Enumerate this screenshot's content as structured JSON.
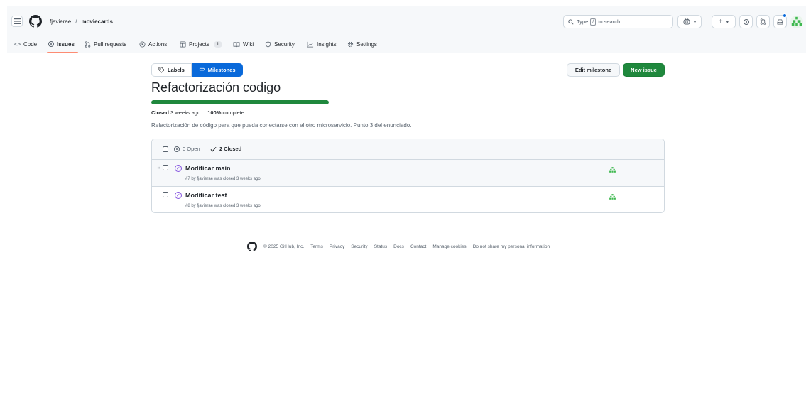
{
  "header": {
    "owner": "fjavierae",
    "separator": "/",
    "repo": "moviecards",
    "search": {
      "prefix": "Type",
      "key": "/",
      "suffix": "to search"
    },
    "copilot_icon": "copilot-icon",
    "plus_label": "+",
    "chevron": "▾"
  },
  "repo_nav": {
    "items": [
      {
        "key": "code",
        "label": "Code",
        "icon": "code-icon"
      },
      {
        "key": "issues",
        "label": "Issues",
        "icon": "issue-opened-icon"
      },
      {
        "key": "pulls",
        "label": "Pull requests",
        "icon": "git-pull-request-icon"
      },
      {
        "key": "actions",
        "label": "Actions",
        "icon": "play-icon"
      },
      {
        "key": "projects",
        "label": "Projects",
        "icon": "table-icon",
        "count": "1"
      },
      {
        "key": "wiki",
        "label": "Wiki",
        "icon": "book-icon"
      },
      {
        "key": "security",
        "label": "Security",
        "icon": "shield-icon"
      },
      {
        "key": "insights",
        "label": "Insights",
        "icon": "graph-icon"
      },
      {
        "key": "settings",
        "label": "Settings",
        "icon": "gear-icon"
      }
    ],
    "active": "issues"
  },
  "subnav": {
    "labels": "Labels",
    "milestones": "Milestones"
  },
  "actions": {
    "edit_milestone": "Edit milestone",
    "new_issue": "New issue"
  },
  "milestone": {
    "title": "Refactorización codigo",
    "progress_percent": 100,
    "status_word": "Closed",
    "status_time": "3 weeks ago",
    "complete_percent": "100%",
    "complete_word": "complete",
    "description": "Refactorización de código para que pueda conectarse con el otro microservicio. Punto 3 del enunciado."
  },
  "issues_header": {
    "open_label": "0 Open",
    "closed_label": "2 Closed"
  },
  "issues": [
    {
      "title": "Modificar main",
      "meta": "#7 by fjavierae was closed 3 weeks ago"
    },
    {
      "title": "Modificar test",
      "meta": "#8 by fjavierae was closed 3 weeks ago"
    }
  ],
  "footer": {
    "copyright": "© 2025 GitHub, Inc.",
    "links": [
      "Terms",
      "Privacy",
      "Security",
      "Status",
      "Docs",
      "Contact",
      "Manage cookies",
      "Do not share my personal information"
    ]
  },
  "colors": {
    "accent_blue": "#0969da",
    "primary_green": "#1f883d",
    "closed_purple": "#8250df",
    "active_underline": "#fd8c73"
  }
}
